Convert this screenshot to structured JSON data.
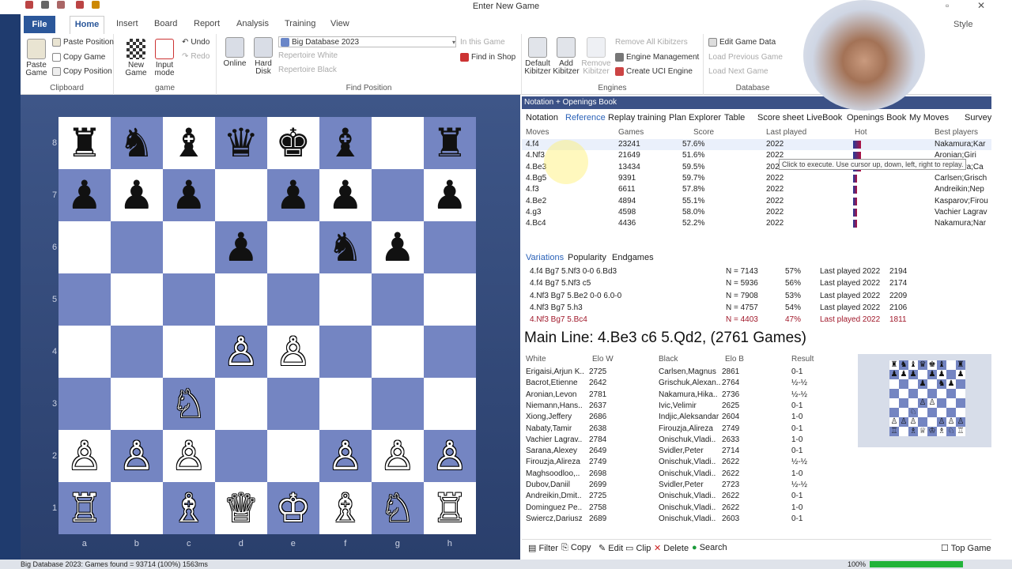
{
  "window": {
    "title": "Enter New Game"
  },
  "ribbon": {
    "tabs": [
      "File",
      "Home",
      "Insert",
      "Board",
      "Report",
      "Analysis",
      "Training",
      "View"
    ],
    "style": "Style",
    "clipboard": {
      "name": "Clipboard",
      "paste_game": "Paste Game",
      "paste_position": "Paste Position",
      "copy_game": "Copy Game",
      "copy_position": "Copy Position"
    },
    "game": {
      "name": "game",
      "new_game": "New Game",
      "input_mode": "Input mode",
      "undo": "Undo",
      "redo": "Redo"
    },
    "find": {
      "name": "Find Position",
      "online": "Online",
      "hard_disk": "Hard Disk",
      "database": "Big Database 2023",
      "rep_white": "Repertoire White",
      "rep_black": "Repertoire Black",
      "in_this_game": "In this Game",
      "find_in_shop": "Find in Shop"
    },
    "engines": {
      "name": "Engines",
      "default_kibitzer": "Default Kibitzer",
      "add_kibitzer": "Add Kibitzer",
      "remove_kibitzer": "Remove Kibitzer",
      "remove_all": "Remove All Kibitzers",
      "engine_mgmt": "Engine Management",
      "create_uci": "Create UCI Engine"
    },
    "database": {
      "name": "Database",
      "edit_game_data": "Edit Game Data",
      "load_prev": "Load Previous Game",
      "load_next": "Load Next Game"
    }
  },
  "board": {
    "ranks": [
      "8",
      "7",
      "6",
      "5",
      "4",
      "3",
      "2",
      "1"
    ],
    "files": [
      "a",
      "b",
      "c",
      "d",
      "e",
      "f",
      "g",
      "h"
    ],
    "position": [
      [
        "♜",
        "♞",
        "♝",
        "♛",
        "♚",
        "♝",
        "",
        "♜"
      ],
      [
        "♟",
        "♟",
        "♟",
        "",
        "♟",
        "♟",
        "",
        "♟"
      ],
      [
        "",
        "",
        "",
        "♟",
        "",
        "♞",
        "♟",
        ""
      ],
      [
        "",
        "",
        "",
        "",
        "",
        "",
        "",
        ""
      ],
      [
        "",
        "",
        "",
        "♙",
        "♙",
        "",
        "",
        ""
      ],
      [
        "",
        "",
        "♘",
        "",
        "",
        "",
        "",
        ""
      ],
      [
        "♙",
        "♙",
        "♙",
        "",
        "",
        "♙",
        "♙",
        "♙"
      ],
      [
        "♖",
        "",
        "♗",
        "♕",
        "♔",
        "♗",
        "♘",
        "♖"
      ]
    ]
  },
  "notation": {
    "header": "Notation + Openings Book",
    "tabs": [
      "Notation",
      "Reference",
      "Replay training",
      "Plan Explorer",
      "Table",
      "Score sheet",
      "LiveBook",
      "Openings Book",
      "My Moves",
      "Surveys"
    ],
    "columns": [
      "Moves",
      "Games",
      "Score",
      "Last played",
      "Hot",
      "Best players"
    ],
    "rows": [
      {
        "move": "4.f4",
        "games": "23241",
        "score": "57.6%",
        "last": "2022",
        "best": "Nakamura;Kar"
      },
      {
        "move": "4.Nf3",
        "games": "21649",
        "score": "51.6%",
        "last": "2022",
        "best": "Aronian;Giri"
      },
      {
        "move": "4.Be3",
        "games": "13434",
        "score": "59.5%",
        "last": "2022",
        "best": "Nakamura;Ca"
      },
      {
        "move": "4.Bg5",
        "games": "9391",
        "score": "59.7%",
        "last": "2022",
        "best": "Carlsen;Grisch"
      },
      {
        "move": "4.f3",
        "games": "6611",
        "score": "57.8%",
        "last": "2022",
        "best": "Andreikin;Nep"
      },
      {
        "move": "4.Be2",
        "games": "4894",
        "score": "55.1%",
        "last": "2022",
        "best": "Kasparov;Firou"
      },
      {
        "move": "4.g3",
        "games": "4598",
        "score": "58.0%",
        "last": "2022",
        "best": "Vachier Lagrav"
      },
      {
        "move": "4.Bc4",
        "games": "4436",
        "score": "52.2%",
        "last": "2022",
        "best": "Nakamura;Nar"
      }
    ],
    "tooltip": "Click to execute. Use cursor up, down, left, right to replay."
  },
  "variations": {
    "tabs": [
      "Variations",
      "Popularity",
      "Endgames"
    ],
    "rows": [
      {
        "line": "4.f4 Bg7 5.Nf3 0-0 6.Bd3",
        "n": "N = 7143",
        "pct": "57%",
        "last": "Last played 2022",
        "elo": "2194"
      },
      {
        "line": "4.f4 Bg7 5.Nf3 c5",
        "n": "N = 5936",
        "pct": "56%",
        "last": "Last played 2022",
        "elo": "2174"
      },
      {
        "line": "4.Nf3 Bg7 5.Be2 0-0 6.0-0",
        "n": "N = 7908",
        "pct": "53%",
        "last": "Last played 2022",
        "elo": "2209"
      },
      {
        "line": "4.Nf3 Bg7 5.h3",
        "n": "N = 4757",
        "pct": "54%",
        "last": "Last played 2022",
        "elo": "2106"
      },
      {
        "line": "4.Nf3 Bg7 5.Bc4",
        "n": "N = 4403",
        "pct": "47%",
        "last": "Last played 2022",
        "elo": "1811"
      }
    ],
    "main_line": "Main Line: 4.Be3 c6 5.Qd2,  (2761 Games)"
  },
  "games": {
    "columns": [
      "White",
      "Elo W",
      "Black",
      "Elo B",
      "Result"
    ],
    "rows": [
      {
        "w": "Erigaisi,Arjun K..",
        "ew": "2725",
        "b": "Carlsen,Magnus",
        "eb": "2861",
        "r": "0-1"
      },
      {
        "w": "Bacrot,Etienne",
        "ew": "2642",
        "b": "Grischuk,Alexan..",
        "eb": "2764",
        "r": "½-½"
      },
      {
        "w": "Aronian,Levon",
        "ew": "2781",
        "b": "Nakamura,Hika..",
        "eb": "2736",
        "r": "½-½"
      },
      {
        "w": "Niemann,Hans..",
        "ew": "2637",
        "b": "Ivic,Velimir",
        "eb": "2625",
        "r": "0-1"
      },
      {
        "w": "Xiong,Jeffery",
        "ew": "2686",
        "b": "Indjic,Aleksandar",
        "eb": "2604",
        "r": "1-0"
      },
      {
        "w": "Nabaty,Tamir",
        "ew": "2638",
        "b": "Firouzja,Alireza",
        "eb": "2749",
        "r": "0-1"
      },
      {
        "w": "Vachier Lagrav..",
        "ew": "2784",
        "b": "Onischuk,Vladi..",
        "eb": "2633",
        "r": "1-0"
      },
      {
        "w": "Sarana,Alexey",
        "ew": "2649",
        "b": "Svidler,Peter",
        "eb": "2714",
        "r": "0-1"
      },
      {
        "w": "Firouzja,Alireza",
        "ew": "2749",
        "b": "Onischuk,Vladi..",
        "eb": "2622",
        "r": "½-½"
      },
      {
        "w": "Maghsoodloo,..",
        "ew": "2698",
        "b": "Onischuk,Vladi..",
        "eb": "2622",
        "r": "1-0"
      },
      {
        "w": "Dubov,Daniil",
        "ew": "2699",
        "b": "Svidler,Peter",
        "eb": "2723",
        "r": "½-½"
      },
      {
        "w": "Andreikin,Dmit..",
        "ew": "2725",
        "b": "Onischuk,Vladi..",
        "eb": "2622",
        "r": "0-1"
      },
      {
        "w": "Dominguez Pe..",
        "ew": "2758",
        "b": "Onischuk,Vladi..",
        "eb": "2622",
        "r": "1-0"
      },
      {
        "w": "Swiercz,Dariusz",
        "ew": "2689",
        "b": "Onischuk,Vladi..",
        "eb": "2603",
        "r": "0-1"
      }
    ]
  },
  "toolbar": {
    "filter": "Filter",
    "copy": "Copy",
    "edit": "Edit",
    "clip": "Clip",
    "delete": "Delete",
    "search": "Search",
    "top_games": "Top Games"
  },
  "status": {
    "text": "Big Database 2023: Games found = 93714 (100%) 1563ms",
    "zoom": "100%",
    "progress": 1.0
  },
  "colors": {
    "accent": "#2b579a",
    "board_dark": "#7485c2",
    "board_bg": "#3e5688"
  }
}
